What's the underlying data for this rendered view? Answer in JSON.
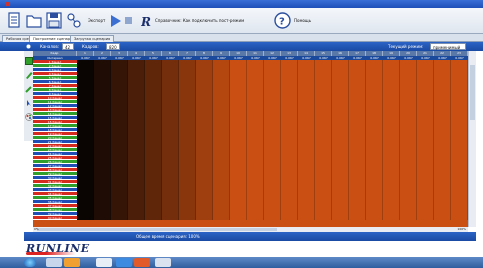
{
  "window": {
    "title": ""
  },
  "toolbar": {
    "play_label": "Экспорт",
    "info_label": "Справочник: Как подключить пост-режим",
    "help_label": "Помощь"
  },
  "tabs": [
    {
      "label": "Рабочая среда"
    },
    {
      "label": "Построение сценария"
    },
    {
      "label": "Загрузка сценария"
    }
  ],
  "infobar": {
    "channels_label": "Каналов:",
    "channels_value": "42",
    "frames_label": "Кадров:",
    "frames_value": "820",
    "mode_label": "Текущий режим:",
    "mode_value": "применимый"
  },
  "grid": {
    "header_label": "Кадр",
    "subheader_label": "Интервал",
    "columns": [
      "1",
      "2",
      "3",
      "4",
      "5",
      "6",
      "7",
      "8",
      "9",
      "10",
      "11",
      "12",
      "13",
      "14",
      "15",
      "16",
      "17",
      "18",
      "19",
      "20",
      "21",
      "22",
      "23"
    ],
    "interval_value": "0.067",
    "rows": [
      {
        "label": "1 Канал",
        "color": "#d42b1e"
      },
      {
        "label": "2 Канал",
        "color": "#2f9e2a"
      },
      {
        "label": "3 Канал",
        "color": "#1f4fb4"
      },
      {
        "label": "4 Канал",
        "color": "#d42b1e"
      },
      {
        "label": "5 Канал",
        "color": "#2f9e2a"
      },
      {
        "label": "6 Канал",
        "color": "#1f4fb4"
      },
      {
        "label": "7 Канал",
        "color": "#d42b1e"
      },
      {
        "label": "8 Канал",
        "color": "#2f9e2a"
      },
      {
        "label": "9 Канал",
        "color": "#1f4fb4"
      },
      {
        "label": "10 Канал",
        "color": "#d42b1e"
      },
      {
        "label": "11 Канал",
        "color": "#2f9e2a"
      },
      {
        "label": "12 Канал",
        "color": "#1f4fb4"
      },
      {
        "label": "13 Канал",
        "color": "#d42b1e"
      },
      {
        "label": "14 Канал",
        "color": "#2f9e2a"
      },
      {
        "label": "15 Канал",
        "color": "#1f4fb4"
      },
      {
        "label": "16 Канал",
        "color": "#d42b1e"
      },
      {
        "label": "17 Канал",
        "color": "#2f9e2a"
      },
      {
        "label": "18 Канал",
        "color": "#1f4fb4"
      },
      {
        "label": "19 Канал",
        "color": "#d42b1e"
      },
      {
        "label": "20 Канал",
        "color": "#2f9e2a"
      },
      {
        "label": "21 Канал",
        "color": "#1f4fb4"
      },
      {
        "label": "22 Канал",
        "color": "#d42b1e"
      },
      {
        "label": "23 Канал",
        "color": "#2f9e2a"
      },
      {
        "label": "24 Канал",
        "color": "#1f4fb4"
      },
      {
        "label": "25 Канал",
        "color": "#d42b1e"
      },
      {
        "label": "26 Канал",
        "color": "#2f9e2a"
      },
      {
        "label": "27 Канал",
        "color": "#1f4fb4"
      },
      {
        "label": "28 Канал",
        "color": "#d42b1e"
      },
      {
        "label": "29 Канал",
        "color": "#2f9e2a"
      },
      {
        "label": "30 Канал",
        "color": "#1f4fb4"
      },
      {
        "label": "31 Канал",
        "color": "#d42b1e"
      },
      {
        "label": "32 Канал",
        "color": "#2f9e2a"
      },
      {
        "label": "33 Канал",
        "color": "#1f4fb4"
      },
      {
        "label": "34 Канал",
        "color": "#d42b1e"
      },
      {
        "label": "35 Канал",
        "color": "#2f9e2a"
      },
      {
        "label": "36 Канал",
        "color": "#1f4fb4"
      },
      {
        "label": "37 Канал",
        "color": "#d42b1e"
      },
      {
        "label": "38 Канал",
        "color": "#2f9e2a"
      },
      {
        "label": "39 Канал",
        "color": "#1f4fb4"
      },
      {
        "label": "40 Канал",
        "color": "#d42b1e"
      }
    ]
  },
  "scroll": {
    "left_percent": "0%",
    "right_percent": "100%"
  },
  "status": {
    "total_time": "Общее время сценария: 100%"
  },
  "footer": {
    "logo_text": "RUNLINE"
  },
  "colors": {
    "accent": "#1f4fb4",
    "grid_fill": "#c94f12",
    "grid_dark": "#0a0503"
  }
}
